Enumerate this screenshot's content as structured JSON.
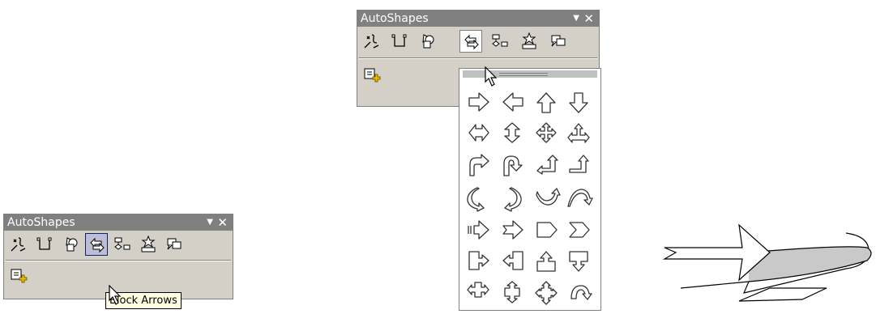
{
  "small_toolbar": {
    "title": "AutoShapes",
    "dropdown_glyph": "▼",
    "close_glyph": "✕",
    "tooltip": "Block Arrows",
    "buttons": [
      "lines-icon",
      "connectors-icon",
      "basic-shapes-icon",
      "block-arrows-icon",
      "flowchart-icon",
      "stars-banners-icon",
      "callouts-icon"
    ],
    "more_button": "more-autoshapes-icon"
  },
  "large_toolbar": {
    "title": "AutoShapes",
    "dropdown_glyph": "▼",
    "close_glyph": "✕",
    "buttons": [
      "lines-icon",
      "connectors-icon",
      "basic-shapes-icon",
      "block-arrows-icon",
      "flowchart-icon",
      "stars-banners-icon",
      "callouts-icon"
    ],
    "more_button": "more-autoshapes-icon"
  },
  "block_arrows_palette": {
    "rows": [
      [
        "right-arrow-icon",
        "left-arrow-icon",
        "up-arrow-icon",
        "down-arrow-icon"
      ],
      [
        "left-right-arrow-icon",
        "up-down-arrow-icon",
        "quad-arrow-icon",
        "left-right-up-arrow-icon"
      ],
      [
        "bent-arrow-icon",
        "u-turn-arrow-icon",
        "left-up-arrow-icon",
        "bent-up-arrow-icon"
      ],
      [
        "curved-right-arrow-icon",
        "curved-left-arrow-icon",
        "curved-up-arrow-icon",
        "curved-down-arrow-icon"
      ],
      [
        "striped-right-arrow-icon",
        "notched-right-arrow-icon",
        "pentagon-icon",
        "chevron-icon"
      ],
      [
        "right-arrow-callout-icon",
        "left-arrow-callout-icon",
        "up-arrow-callout-icon",
        "down-arrow-callout-icon"
      ],
      [
        "left-right-arrow-callout-icon",
        "up-down-arrow-callout-icon",
        "quad-arrow-callout-icon",
        "circular-arrow-icon"
      ]
    ]
  },
  "drawn_shape": "curved-block-arrow-shape",
  "colors": {
    "toolbar_bg": "#d4d0c8",
    "title_bg": "#808080",
    "tooltip_bg": "#ffffe1",
    "highlight_border": "#0a246a"
  }
}
